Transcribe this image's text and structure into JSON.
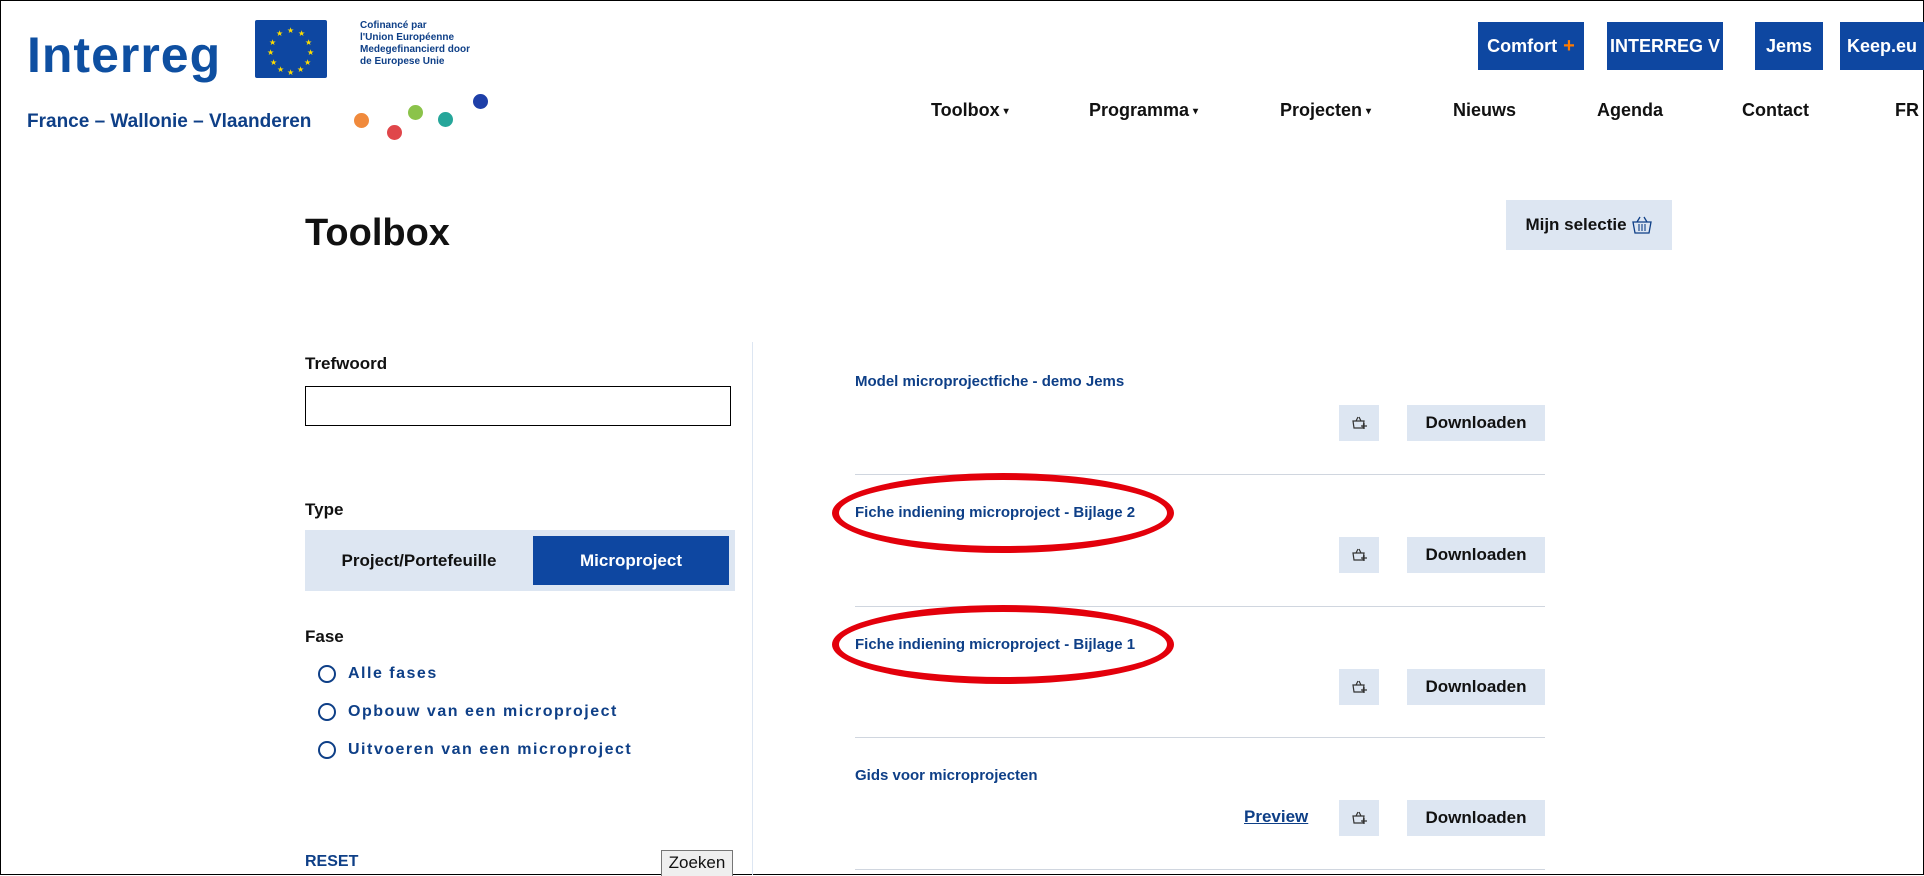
{
  "header": {
    "logo_text": "Interreg",
    "cofinance_lines": [
      "Cofinancé par",
      "l'Union Européenne",
      "Medegefinancierd door",
      "de Europese Unie"
    ],
    "region_text": "France – Wallonie – Vlaanderen",
    "top_buttons": [
      {
        "label": "Comfort",
        "suffix": "+"
      },
      {
        "label": "INTERREG V"
      },
      {
        "label": "Jems"
      },
      {
        "label": "Keep.eu"
      }
    ],
    "nav": [
      {
        "label": "Toolbox",
        "dropdown": true
      },
      {
        "label": "Programma",
        "dropdown": true
      },
      {
        "label": "Projecten",
        "dropdown": true
      },
      {
        "label": "Nieuws",
        "dropdown": false
      },
      {
        "label": "Agenda",
        "dropdown": false
      },
      {
        "label": "Contact",
        "dropdown": false
      },
      {
        "label": "FR",
        "dropdown": false
      }
    ],
    "caret_glyph": "▾"
  },
  "page": {
    "title": "Toolbox",
    "my_selection_label": "Mijn selectie",
    "basket_icon": "basket-icon"
  },
  "filters": {
    "keyword_label": "Trefwoord",
    "keyword_value": "",
    "type_label": "Type",
    "type_options": [
      {
        "label": "Project/Portefeuille",
        "selected": false
      },
      {
        "label": "Microproject",
        "selected": true
      }
    ],
    "phase_label": "Fase",
    "phase_options": [
      {
        "label": "Alle fases"
      },
      {
        "label": "Opbouw van een microproject"
      },
      {
        "label": "Uitvoeren van een microproject"
      }
    ],
    "reset_label": "RESET",
    "search_label": "Zoeken"
  },
  "results": [
    {
      "title": "Model microprojectfiche - demo Jems",
      "preview": false,
      "highlighted": false
    },
    {
      "title": "Fiche indiening microproject - Bijlage 2",
      "preview": false,
      "highlighted": true
    },
    {
      "title": "Fiche indiening microproject - Bijlage 1",
      "preview": false,
      "highlighted": true
    },
    {
      "title": "Gids voor microprojecten",
      "preview": true,
      "highlighted": false
    }
  ],
  "result_actions": {
    "download_label": "Downloaden",
    "preview_label": "Preview",
    "add_basket_icon": "add-to-selection-icon"
  },
  "colors": {
    "primary": "#0e47a1",
    "link": "#0e3f87",
    "light_bg": "#dde6f2",
    "highlight": "#e3000b",
    "accent_orange": "#ff7a00"
  }
}
